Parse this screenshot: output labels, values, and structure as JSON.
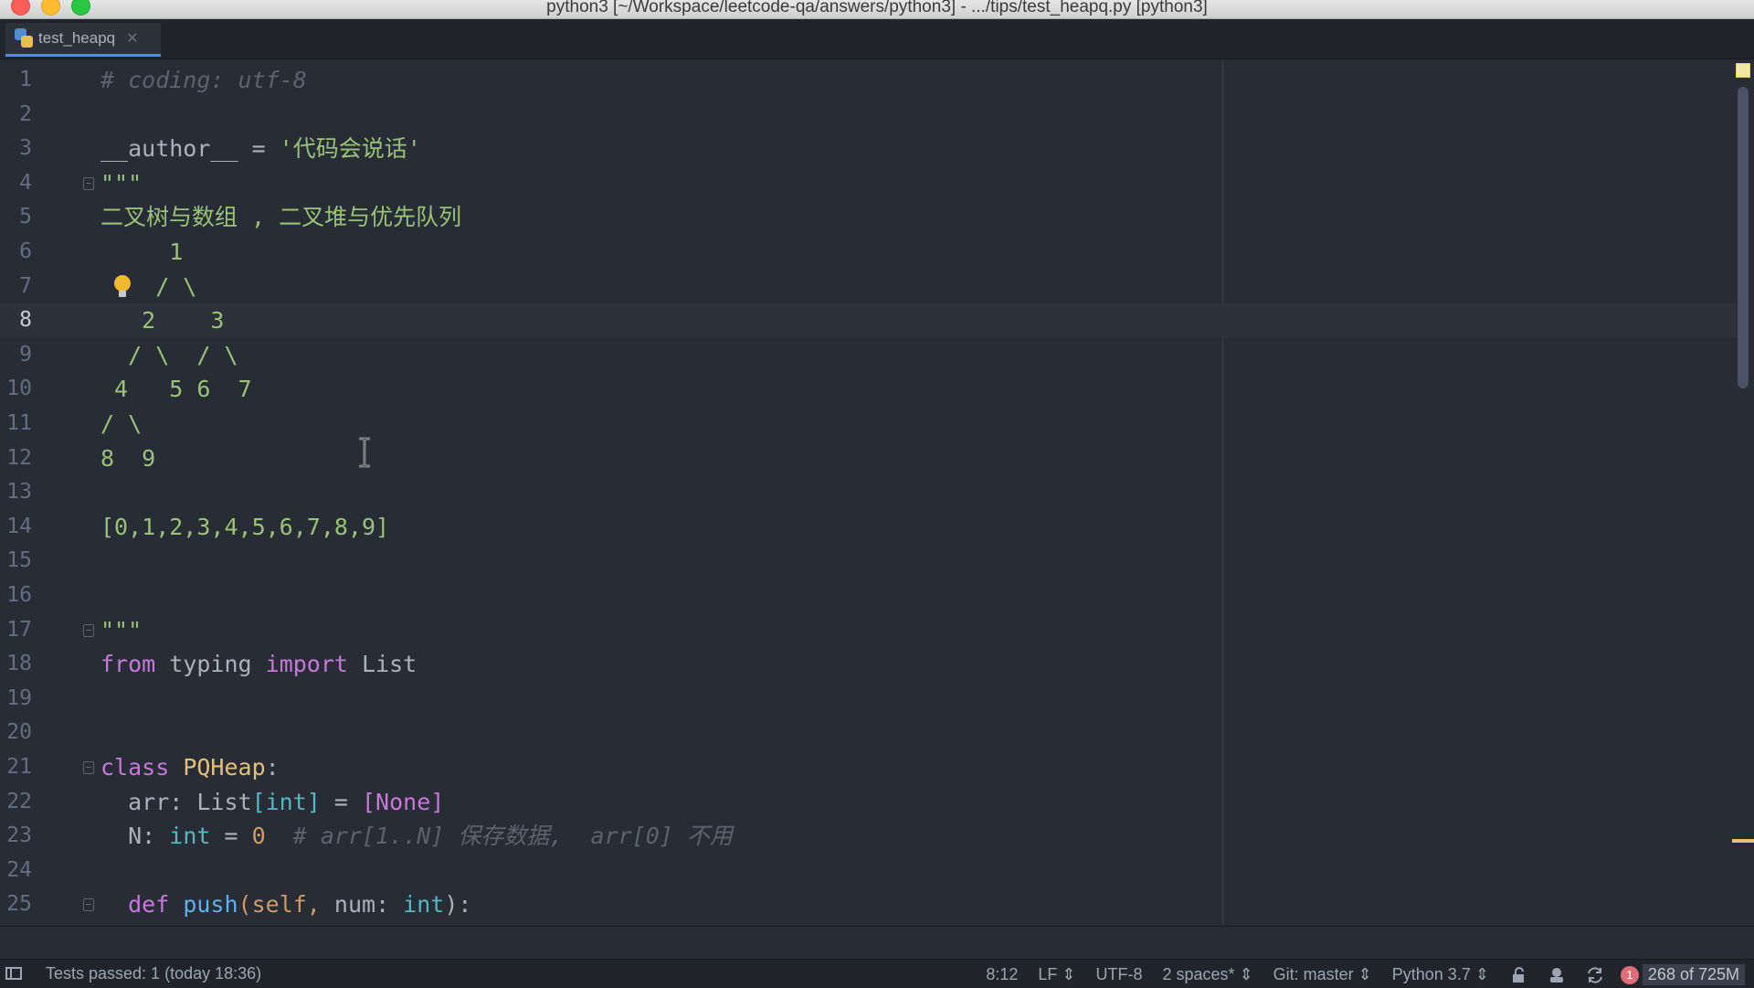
{
  "window": {
    "title": "python3 [~/Workspace/leetcode-qa/answers/python3] - .../tips/test_heapq.py [python3]"
  },
  "tabs": [
    {
      "label": "test_heapq",
      "icon": "python-file-icon",
      "active": true
    }
  ],
  "editor": {
    "current_line": 8,
    "lines": [
      {
        "n": "1",
        "tokens": [
          {
            "t": "# coding: utf-8",
            "c": "cm"
          }
        ]
      },
      {
        "n": "2",
        "tokens": []
      },
      {
        "n": "3",
        "tokens": [
          {
            "t": "__author__ = ",
            "c": "plain"
          },
          {
            "t": "'代码会说话'",
            "c": "str"
          }
        ]
      },
      {
        "n": "4",
        "tokens": [
          {
            "t": "\"\"\"",
            "c": "str"
          }
        ],
        "fold": true
      },
      {
        "n": "5",
        "tokens": [
          {
            "t": "二叉树与数组 , 二叉堆与优先队列",
            "c": "str"
          }
        ]
      },
      {
        "n": "6",
        "tokens": [
          {
            "t": "     1",
            "c": "str"
          }
        ]
      },
      {
        "n": "7",
        "tokens": [
          {
            "t": "    / \\",
            "c": "str"
          }
        ]
      },
      {
        "n": "8",
        "tokens": [
          {
            "t": "   2    3",
            "c": "str"
          }
        ]
      },
      {
        "n": "9",
        "tokens": [
          {
            "t": "  / \\  / \\",
            "c": "str"
          }
        ]
      },
      {
        "n": "10",
        "tokens": [
          {
            "t": " 4   5 6  7",
            "c": "str"
          }
        ]
      },
      {
        "n": "11",
        "tokens": [
          {
            "t": "/ \\",
            "c": "str"
          }
        ]
      },
      {
        "n": "12",
        "tokens": [
          {
            "t": "8  9",
            "c": "str"
          }
        ]
      },
      {
        "n": "13",
        "tokens": []
      },
      {
        "n": "14",
        "tokens": [
          {
            "t": "[0,1,2,3,4,5,6,7,8,9]",
            "c": "str"
          }
        ]
      },
      {
        "n": "15",
        "tokens": []
      },
      {
        "n": "16",
        "tokens": []
      },
      {
        "n": "17",
        "tokens": [
          {
            "t": "\"\"\"",
            "c": "str"
          }
        ],
        "fold": true
      },
      {
        "n": "18",
        "tokens": [
          {
            "t": "from",
            "c": "kw"
          },
          {
            "t": " typing ",
            "c": "plain"
          },
          {
            "t": "import",
            "c": "kw"
          },
          {
            "t": " List",
            "c": "plain"
          }
        ]
      },
      {
        "n": "19",
        "tokens": []
      },
      {
        "n": "20",
        "tokens": []
      },
      {
        "n": "21",
        "tokens": [
          {
            "t": "class",
            "c": "kw"
          },
          {
            "t": " ",
            "c": "plain"
          },
          {
            "t": "PQHeap",
            "c": "cls"
          },
          {
            "t": ":",
            "c": "plain"
          }
        ],
        "fold": true
      },
      {
        "n": "22",
        "tokens": [
          {
            "t": "  arr: List",
            "c": "plain"
          },
          {
            "t": "[int]",
            "c": "bi"
          },
          {
            "t": " = ",
            "c": "plain"
          },
          {
            "t": "[None]",
            "c": "kw"
          }
        ]
      },
      {
        "n": "23",
        "tokens": [
          {
            "t": "  N: ",
            "c": "plain"
          },
          {
            "t": "int",
            "c": "bi"
          },
          {
            "t": " = ",
            "c": "plain"
          },
          {
            "t": "0",
            "c": "num"
          },
          {
            "t": "  # arr[1..N] 保存数据,  arr[0] 不用",
            "c": "cm"
          }
        ]
      },
      {
        "n": "24",
        "tokens": []
      },
      {
        "n": "25",
        "tokens": [
          {
            "t": "  def",
            "c": "kw"
          },
          {
            "t": " ",
            "c": "plain"
          },
          {
            "t": "push",
            "c": "fn"
          },
          {
            "t": "(self, ",
            "c": "num"
          },
          {
            "t": "num",
            "c": "plain"
          },
          {
            "t": ": ",
            "c": "plain"
          },
          {
            "t": "int",
            "c": "bi"
          },
          {
            "t": "):",
            "c": "plain"
          }
        ],
        "fold": true
      }
    ]
  },
  "statusbar": {
    "message": "Tests passed: 1 (today 18:36)",
    "position": "8:12",
    "line_ending": "LF ⇕",
    "encoding": "UTF-8",
    "indent": "2 spaces* ⇕",
    "vcs": "Git: master ⇕",
    "interpreter": "Python 3.7 ⇕",
    "error_count": "1",
    "memory": "268 of 725M"
  },
  "colors": {
    "background": "#282c34",
    "comment": "#5c6370",
    "string": "#98c379",
    "keyword": "#c678dd",
    "class": "#e5c07b",
    "function": "#61afef",
    "number": "#d19a66",
    "builtin": "#56b6c2"
  }
}
